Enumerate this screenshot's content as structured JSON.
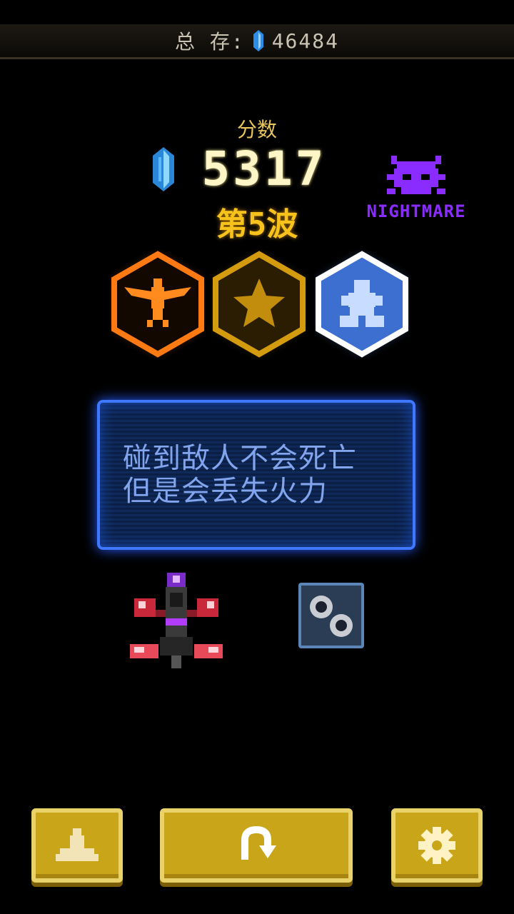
{
  "header": {
    "total_label": "总 存:",
    "gem_icon": "blue-crystal-icon",
    "total_value": "46484"
  },
  "results": {
    "score_label": "分数",
    "score_value": "5317",
    "wave_label": "第5波",
    "difficulty_label": "NIGHTMARE",
    "medals": [
      "eagle-medal-icon",
      "star-medal-icon",
      "robot-medal-icon"
    ]
  },
  "tip": {
    "line1": "碰到敌人不会死亡",
    "line2": "但是会丢失火力"
  },
  "loadout": {
    "ship_icon": "player-ship-icon",
    "powerup_icon": "twin-orb-powerup-icon"
  },
  "buttons": {
    "hangar_icon": "ship-hangar-icon",
    "retry_icon": "retry-arrow-icon",
    "settings_icon": "gear-icon"
  },
  "colors": {
    "gold": "#c9a51a",
    "orange": "#ff7a12",
    "blue": "#3f78ff",
    "purple": "#8a2cff"
  }
}
